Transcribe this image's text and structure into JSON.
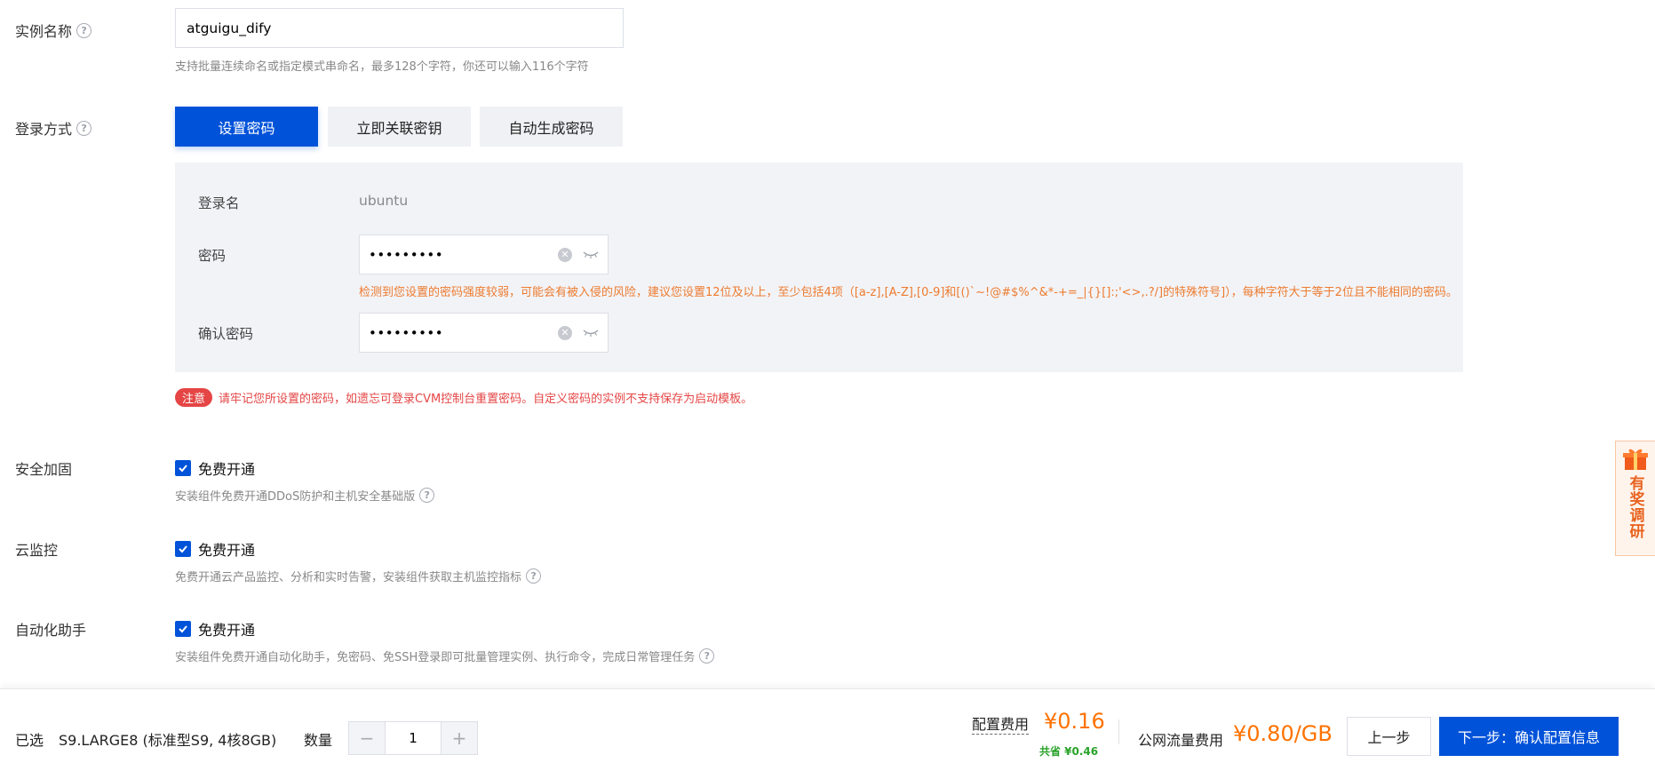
{
  "instance_name": {
    "label": "实例名称",
    "value": "atguigu_dify",
    "hint": "支持批量连续命名或指定模式串命名，最多128个字符，你还可以输入116个字符"
  },
  "login": {
    "label": "登录方式",
    "tabs": [
      {
        "label": "设置密码",
        "active": true
      },
      {
        "label": "立即关联密钥",
        "active": false
      },
      {
        "label": "自动生成密码",
        "active": false
      }
    ],
    "username_label": "登录名",
    "username_value": "ubuntu",
    "password_label": "密码",
    "password_mask": "•••••••••",
    "confirm_label": "确认密码",
    "confirm_mask": "•••••••••",
    "warning": "检测到您设置的密码强度较弱，可能会有被入侵的风险，建议您设置12位及以上，至少包括4项（[a-z],[A-Z],[0-9]和[()`~!@#$%^&*-+=_|{}[]:;'<>,.?/]的特殊符号]），每种字符大于等于2位且不能相同的密码。"
  },
  "note": {
    "badge": "注意",
    "text": "请牢记您所设置的密码，如遗忘可登录CVM控制台重置密码。自定义密码的实例不支持保存为启动模板。"
  },
  "security": {
    "label": "安全加固",
    "checkbox_label": "免费开通",
    "checked": true,
    "hint": "安装组件免费开通DDoS防护和主机安全基础版"
  },
  "monitoring": {
    "label": "云监控",
    "checkbox_label": "免费开通",
    "checked": true,
    "hint": "免费开通云产品监控、分析和实时告警，安装组件获取主机监控指标"
  },
  "automation": {
    "label": "自动化助手",
    "checkbox_label": "免费开通",
    "checked": true,
    "hint": "安装组件免费开通自动化助手，免密码、免SSH登录即可批量管理实例、执行命令，完成日常管理任务"
  },
  "survey": {
    "label": "有奖调研"
  },
  "bottom": {
    "selected_label": "已选",
    "selected_value": "S9.LARGE8 (标准型S9, 4核8GB)",
    "quantity_label": "数量",
    "quantity_value": "1",
    "minus": "−",
    "plus": "+",
    "config_fee_label": "配置费用",
    "config_fee_value": "¥0.16",
    "saving": "共省 ¥0.46",
    "traffic_fee_label": "公网流量费用",
    "traffic_fee_value": "¥0.80/GB",
    "prev_label": "上一步",
    "next_label": "下一步：确认配置信息"
  },
  "colors": {
    "primary": "#0052d9",
    "warning": "#ed7b2f",
    "danger": "#e54545",
    "price": "#ff7200",
    "saving": "#29a329"
  }
}
